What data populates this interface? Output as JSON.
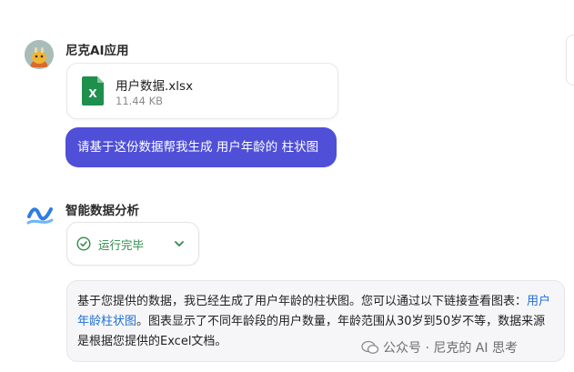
{
  "user": {
    "name": "尼克AI应用",
    "attachment": {
      "icon": "excel-file-icon",
      "letter": "X",
      "name": "用户数据.xlsx",
      "size": "11.44 KB"
    },
    "message": "请基于这份数据帮我生成 用户年龄的 柱状图"
  },
  "assistant": {
    "name": "智能数据分析",
    "status": {
      "text": "运行完毕",
      "icon": "check-circle-icon",
      "toggle_icon": "chevron-down-icon"
    },
    "result": {
      "part1": "基于您提供的数据，我已经生成了用户年龄的柱状图。您可以通过以下链接查看图表：",
      "link": "用户年龄柱状图",
      "part2": "。图表显示了不同年龄段的用户数量，年龄范围从30岁到50岁不等，数据来源是根据您提供的Excel文档。"
    }
  },
  "watermark": "公众号 · 尼克的 AI 思考",
  "colors": {
    "bubble": "#4f4fd8",
    "status_green": "#2f8a4d",
    "excel_green": "#1f8f4e",
    "link": "#1f6fd6"
  }
}
